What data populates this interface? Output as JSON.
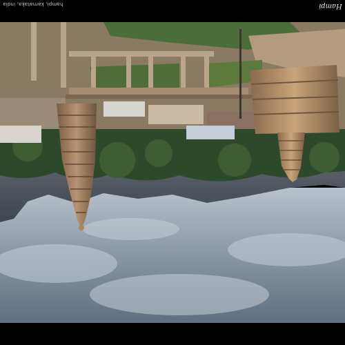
{
  "image": {
    "orientation": "upside-down",
    "subject": "Hampi temple ruins",
    "sky_colors": [
      "#5f6f80",
      "#8e9aa6",
      "#b9c2cc"
    ],
    "foliage_colors": [
      "#2c4a2a",
      "#4a6d3a",
      "#6e8a45"
    ],
    "stone_colors": [
      "#8b6b4f",
      "#b08a66",
      "#c9a47a"
    ]
  },
  "captions": {
    "top_left": "hampi, karnataka, india",
    "top_right": "Hampi"
  }
}
